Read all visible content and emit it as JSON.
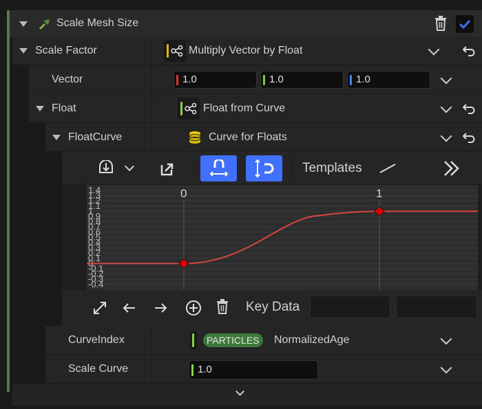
{
  "header": {
    "title": "Scale Mesh Size"
  },
  "rows": {
    "scale_factor": {
      "label": "Scale Factor",
      "value": "Multiply Vector by Float"
    },
    "vector": {
      "label": "Vector",
      "x": "1.0",
      "y": "1.0",
      "z": "1.0"
    },
    "float": {
      "label": "Float",
      "value": "Float from Curve"
    },
    "float_curve": {
      "label": "FloatCurve",
      "value": "Curve for Floats"
    },
    "curve_index": {
      "label": "CurveIndex",
      "badge": "PARTICLES",
      "value": "NormalizedAge"
    },
    "scale_curve": {
      "label": "Scale Curve",
      "value": "1.0"
    }
  },
  "curve_toolbar": {
    "templates_label": "Templates"
  },
  "curve_graph": {
    "x_ticks": [
      "0",
      "1"
    ],
    "y_ticks": [
      "1.4",
      "1.3",
      "1.2",
      "1.1",
      "1",
      "0.9",
      "0.8",
      "0.7",
      "0.6",
      "0.5",
      "0.4",
      "0.3",
      "0.2",
      "0.1",
      "0",
      "-0.1",
      "-0.2",
      "-0.3",
      "-0.4"
    ],
    "keys": [
      {
        "time": 0,
        "value": 0
      },
      {
        "time": 1,
        "value": 1
      }
    ]
  },
  "key_bar": {
    "key_data_label": "Key Data",
    "time_value": "",
    "value_value": ""
  },
  "colors": {
    "accent_blue": "#3f70ff",
    "vector_x": "#e0342c",
    "vector_y": "#7ac943",
    "vector_z": "#3b86ff",
    "curve": "#d94444",
    "key": "#e00000",
    "badge": "#3d7a3a",
    "input_accent": "#8ad440"
  }
}
